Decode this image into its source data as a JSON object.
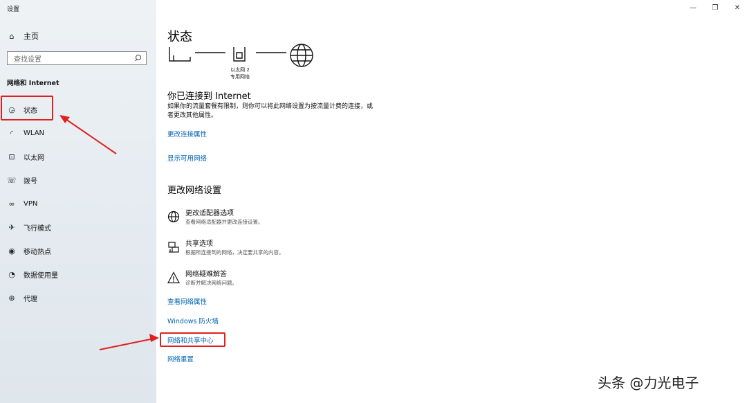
{
  "window": {
    "title": "设置"
  },
  "sidebar": {
    "home_label": "主页",
    "search_placeholder": "查找设置",
    "section_title": "网络和 Internet",
    "items": [
      {
        "label": "状态",
        "icon": "globe-status-icon",
        "selected": true
      },
      {
        "label": "WLAN",
        "icon": "wifi-icon"
      },
      {
        "label": "以太网",
        "icon": "ethernet-icon"
      },
      {
        "label": "拨号",
        "icon": "dialup-icon"
      },
      {
        "label": "VPN",
        "icon": "vpn-icon"
      },
      {
        "label": "飞行模式",
        "icon": "airplane-icon"
      },
      {
        "label": "移动热点",
        "icon": "hotspot-icon"
      },
      {
        "label": "数据使用量",
        "icon": "data-usage-icon"
      },
      {
        "label": "代理",
        "icon": "globe-icon"
      }
    ]
  },
  "main": {
    "title": "状态",
    "connection": {
      "name": "以太网 2",
      "type": "专用网络"
    },
    "connected_heading": "你已连接到 Internet",
    "connected_desc": "如果你的流量套餐有限制，则你可以将此网络设置为按流量计费的连接，或者更改其他属性。",
    "link_change_props": "更改连接属性",
    "link_show_networks": "显示可用网络",
    "change_heading": "更改网络设置",
    "options": [
      {
        "title": "更改适配器选项",
        "desc": "查看网络适配器并更改连接设置。",
        "icon": "adapter-globe-icon"
      },
      {
        "title": "共享选项",
        "desc": "根据所连接到的网络，决定要共享的内容。",
        "icon": "sharing-icon"
      },
      {
        "title": "网络疑难解答",
        "desc": "诊断并解决网络问题。",
        "icon": "warning-icon"
      }
    ],
    "links": [
      "查看网络属性",
      "Windows 防火墙",
      "网络和共享中心",
      "网络重置"
    ]
  },
  "watermark": "头条 @力光电子",
  "colors": {
    "link": "#0063b1",
    "highlight": "#e02020"
  }
}
